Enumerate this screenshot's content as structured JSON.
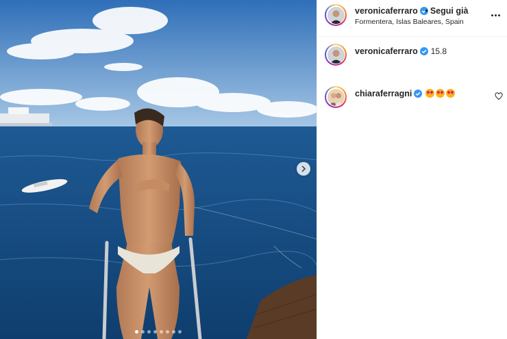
{
  "header": {
    "username": "veronicaferraro",
    "follow_state": "• Segui già",
    "location": "Formentera, Islas Baleares, Spain"
  },
  "caption": {
    "username": "veronicaferraro",
    "text": "15.8"
  },
  "comments": [
    {
      "username": "chiaraferragni",
      "text_emojis": [
        "smiling-face-with-heart-eyes",
        "smiling-face-with-heart-eyes",
        "smiling-face-with-heart-eyes"
      ]
    }
  ],
  "carousel": {
    "slide_count": 8,
    "active_index": 0
  },
  "colors": {
    "verified": "#3897f0",
    "text": "#262626",
    "sea": "#1b4f86",
    "sky": "#4a86c8"
  }
}
